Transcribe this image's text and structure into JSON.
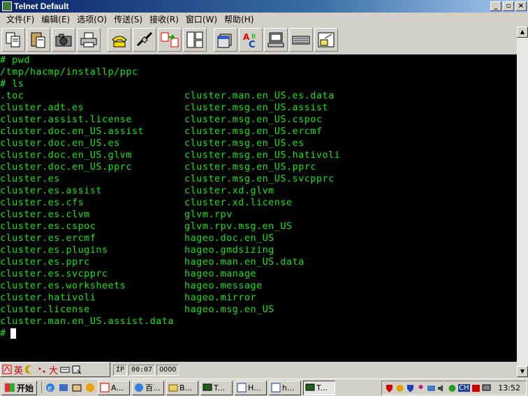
{
  "window": {
    "title": "Telnet Default"
  },
  "menu": [
    {
      "label": "文件",
      "key": "(F)"
    },
    {
      "label": "编辑",
      "key": "(E)"
    },
    {
      "label": "选项",
      "key": "(O)"
    },
    {
      "label": "传送",
      "key": "(S)"
    },
    {
      "label": "接收",
      "key": "(R)"
    },
    {
      "label": "窗口",
      "key": "(W)"
    },
    {
      "label": "帮助",
      "key": "(H)"
    }
  ],
  "toolbar_icons": [
    "copy-icon",
    "paste-icon",
    "camera-icon",
    "print-icon",
    "phone-icon",
    "disconnect-icon",
    "transfer-icon",
    "layout-icon",
    "files-icon",
    "spellcheck-icon",
    "computer-icon",
    "keyboard-icon",
    "image-icon"
  ],
  "terminal": {
    "lines": [
      "# pwd",
      "/tmp/hacmp/installp/ppc",
      "# ls"
    ],
    "col1": [
      ".toc",
      "cluster.adt.es",
      "cluster.assist.license",
      "cluster.doc.en_US.assist",
      "cluster.doc.en_US.es",
      "cluster.doc.en_US.glvm",
      "cluster.doc.en_US.pprc",
      "cluster.es",
      "cluster.es.assist",
      "cluster.es.cfs",
      "cluster.es.clvm",
      "cluster.es.cspoc",
      "cluster.es.ercmf",
      "cluster.es.plugins",
      "cluster.es.pprc",
      "cluster.es.svcpprc",
      "cluster.es.worksheets",
      "cluster.hativoli",
      "cluster.license",
      "cluster.man.en_US.assist.data"
    ],
    "col2": [
      "cluster.man.en_US.es.data",
      "cluster.msg.en_US.assist",
      "cluster.msg.en_US.cspoc",
      "cluster.msg.en_US.ercmf",
      "cluster.msg.en_US.es",
      "cluster.msg.en_US.hativoli",
      "cluster.msg.en_US.pprc",
      "cluster.msg.en_US.svcpprc",
      "cluster.xd.glvm",
      "cluster.xd.license",
      "glvm.rpv",
      "glvm.rpv.msg.en_US",
      "hageo.doc.en_US",
      "hageo.gmdsizing",
      "hageo.man.en_US.data",
      "hageo.manage",
      "hageo.message",
      "hageo.mirror",
      "hageo.msg.en_US"
    ],
    "prompt": "#"
  },
  "status": {
    "mode": "IP",
    "time": "00:07",
    "indicator": "OOOO"
  },
  "ime": {
    "label": "英",
    "width": "大"
  },
  "taskbar": {
    "start": "开始",
    "tasks": [
      "A...",
      "百...",
      "B...",
      "T...",
      "H...",
      "h...",
      "T..."
    ],
    "tray_lang": "CH",
    "clock": "13:52"
  },
  "colors": {
    "terminal_text": "#18e018",
    "terminal_bg": "#000000",
    "titlebar": "#0a246a"
  }
}
